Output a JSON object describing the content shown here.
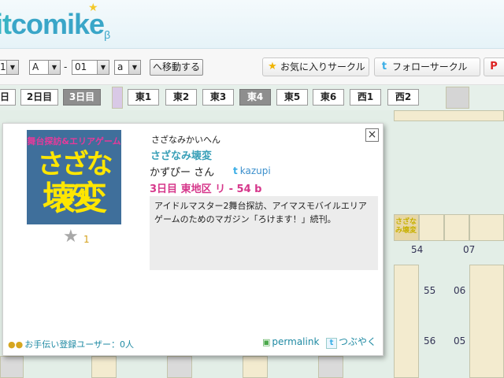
{
  "header": {
    "logo_part1": "it",
    "logo_part2": "comike",
    "logo_beta": "β"
  },
  "toolbar": {
    "day_select": "1",
    "block_select": "A",
    "separator": "-",
    "number_select": "01",
    "sub_select": "a",
    "move_button": "へ移動する",
    "favorite_button": "お気に入りサークル",
    "follow_button": "フォローサークル",
    "pdf_icon_label": "P"
  },
  "tabs": [
    {
      "label": "日",
      "active": false
    },
    {
      "label": "2日目",
      "active": false
    },
    {
      "label": "3日目",
      "active": true
    },
    {
      "label": "東1",
      "active": false
    },
    {
      "label": "東2",
      "active": false
    },
    {
      "label": "東3",
      "active": false
    },
    {
      "label": "東4",
      "active": true
    },
    {
      "label": "東5",
      "active": false
    },
    {
      "label": "東6",
      "active": false
    },
    {
      "label": "西1",
      "active": false
    },
    {
      "label": "西2",
      "active": false
    }
  ],
  "map": {
    "numbers": [
      "54",
      "07",
      "55",
      "06",
      "56",
      "05"
    ],
    "mini_cut_text": "さざなみ壊変"
  },
  "popup": {
    "cut_top_text": "舞台探訪&エリアゲーム",
    "cut_big_line1": "さざなみ",
    "cut_big_line2": "壊変",
    "favorite_count": "1",
    "ruby": "さざなみかいへん",
    "circle_name": "さざなみ壊変",
    "author": "かずぴー さん",
    "twitter_id": "kazupi",
    "location": "3日目 東地区 リ - 54 b",
    "description": "アイドルマスター2舞台探訪、アイマスモバイルエリアゲームのためのマガジン「ろけます！」続刊。",
    "helpers": "お手伝い登録ユーザー：0人",
    "permalink": "permalink",
    "tweet": "つぶやく",
    "close_icon": "×"
  },
  "colors": {
    "accent": "#3aa0b8",
    "location": "#d6378b",
    "map_bg": "#e3eee7",
    "cell": "#f3ebcf"
  }
}
